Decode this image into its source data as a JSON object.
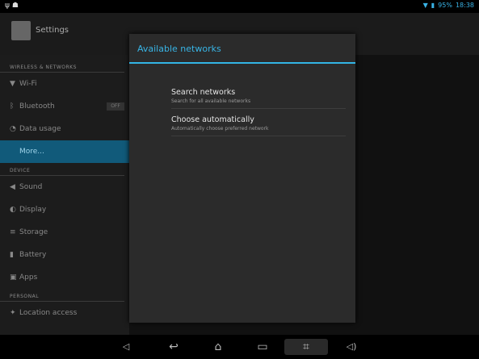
{
  "status": {
    "left_icons": [
      "usb-icon",
      "android-icon"
    ],
    "right_icons": [
      "wifi-icon",
      "battery-icon"
    ],
    "battery": "95%",
    "time": "18:38"
  },
  "action_bar": {
    "title": "Settings"
  },
  "sidebar": {
    "section_wireless": "WIRELESS & NETWORKS",
    "wifi": {
      "label": "Wi-Fi",
      "icon": "wifi-icon"
    },
    "bluetooth": {
      "label": "Bluetooth",
      "icon": "bluetooth-icon",
      "toggle": "OFF"
    },
    "data_usage": {
      "label": "Data usage",
      "icon": "data-usage-icon"
    },
    "more": {
      "label": "More..."
    },
    "section_device": "DEVICE",
    "sound": {
      "label": "Sound",
      "icon": "speaker-icon"
    },
    "display": {
      "label": "Display",
      "icon": "display-icon"
    },
    "storage": {
      "label": "Storage",
      "icon": "storage-icon"
    },
    "battery": {
      "label": "Battery",
      "icon": "battery-icon"
    },
    "apps": {
      "label": "Apps",
      "icon": "apps-icon"
    },
    "section_personal": "PERSONAL",
    "location": {
      "label": "Location access",
      "icon": "location-icon"
    }
  },
  "dialog": {
    "title": "Available networks",
    "items": [
      {
        "title": "Search networks",
        "subtitle": "Search for all available networks"
      },
      {
        "title": "Choose automatically",
        "subtitle": "Automatically choose preferred network"
      }
    ]
  },
  "nav": {
    "buttons": [
      "volume-down-icon",
      "back-icon",
      "home-icon",
      "recent-apps-icon",
      "screenshot-icon",
      "volume-up-icon"
    ]
  }
}
